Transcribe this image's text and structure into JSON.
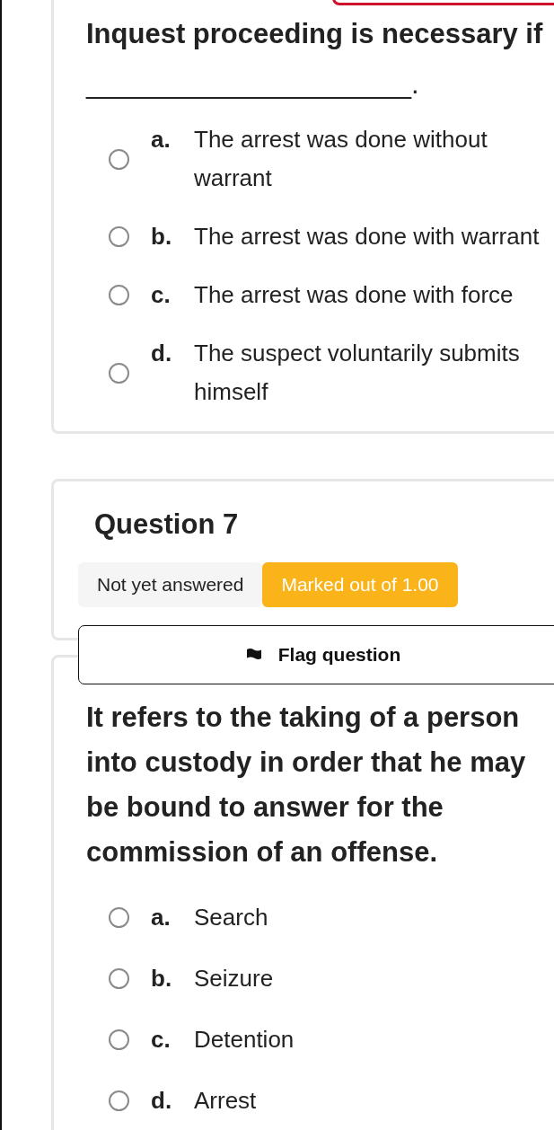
{
  "previous_question": {
    "text": "Inquest proceeding is necessary if",
    "blank": "_____________________.",
    "options": [
      {
        "letter": "a.",
        "text": "The arrest was done without warrant",
        "selected": false
      },
      {
        "letter": "b.",
        "text": "The arrest was done with warrant",
        "selected": false
      },
      {
        "letter": "c.",
        "text": "The arrest was done with force",
        "selected": false
      },
      {
        "letter": "d.",
        "text": "The suspect voluntarily submits himself",
        "selected": false
      }
    ]
  },
  "question_info": {
    "title": "Question 7",
    "status": "Not yet answered",
    "marks": "Marked out of 1.00",
    "flag": {
      "label": "Flag question",
      "flagged": false
    }
  },
  "question": {
    "text": "It refers to the taking of a person into custody in order that he may be bound to answer for the commission of an offense.",
    "options": [
      {
        "letter": "a.",
        "text": "Search",
        "selected": false
      },
      {
        "letter": "b.",
        "text": "Seizure",
        "selected": false
      },
      {
        "letter": "c.",
        "text": "Detention",
        "selected": false
      },
      {
        "letter": "d.",
        "text": "Arrest",
        "selected": false
      }
    ]
  }
}
